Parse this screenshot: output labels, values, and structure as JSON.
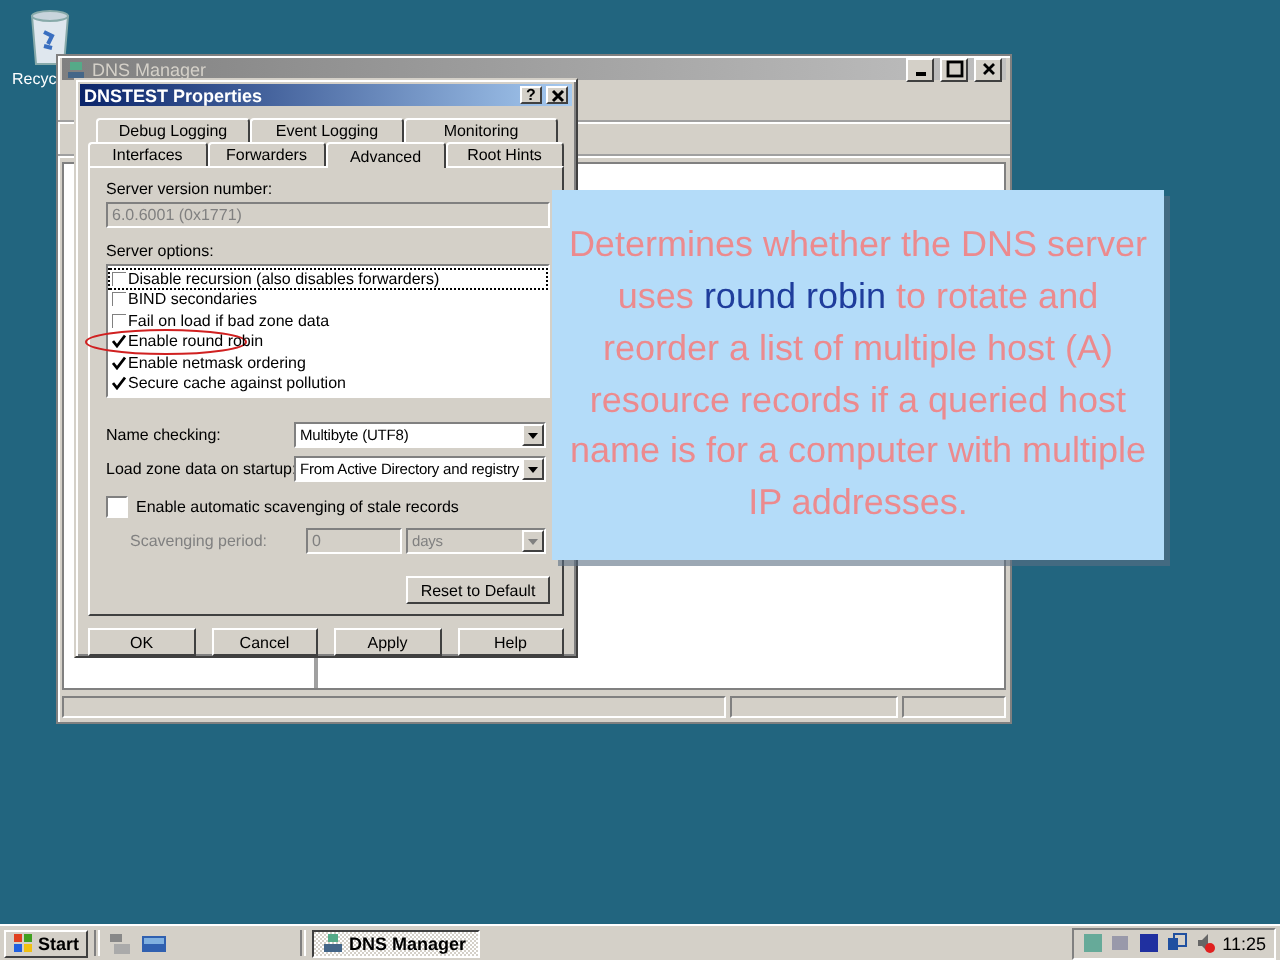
{
  "desktop": {
    "icon_label": "Recyc"
  },
  "background_window": {
    "title": "DNS Manager"
  },
  "dialog": {
    "title": "DNSTEST Properties",
    "help_button": "?",
    "tab_rows": [
      [
        {
          "label": "Debug Logging",
          "selected": false
        },
        {
          "label": "Event Logging",
          "selected": false
        },
        {
          "label": "Monitoring",
          "selected": false
        }
      ],
      [
        {
          "label": "Interfaces",
          "selected": false
        },
        {
          "label": "Forwarders",
          "selected": false
        },
        {
          "label": "Advanced",
          "selected": true
        },
        {
          "label": "Root Hints",
          "selected": false
        }
      ]
    ],
    "version_label": "Server version number:",
    "version_value": "6.0.6001 (0x1771)",
    "options_label": "Server options:",
    "options": [
      {
        "label": "Disable recursion (also disables forwarders)",
        "checked": false,
        "focused": true,
        "circled": false
      },
      {
        "label": "BIND secondaries",
        "checked": false,
        "focused": false,
        "circled": false
      },
      {
        "label": "Fail on load if bad zone data",
        "checked": false,
        "focused": false,
        "circled": false
      },
      {
        "label": "Enable round robin",
        "checked": true,
        "focused": false,
        "circled": true
      },
      {
        "label": "Enable netmask ordering",
        "checked": true,
        "focused": false,
        "circled": false
      },
      {
        "label": "Secure cache against pollution",
        "checked": true,
        "focused": false,
        "circled": false
      }
    ],
    "dropdowns": [
      {
        "label": "Name checking:",
        "value": "Multibyte (UTF8)"
      },
      {
        "label": "Load zone data on startup:",
        "value": "From Active Directory and registry"
      }
    ],
    "scavenging": {
      "label": "Enable automatic scavenging of stale records",
      "checked": false
    },
    "period": {
      "label": "Scavenging period:",
      "value": "0",
      "unit": "days",
      "disabled": true
    },
    "reset_button": "Reset to Default",
    "buttons": [
      "OK",
      "Cancel",
      "Apply",
      "Help"
    ]
  },
  "callout": {
    "parts": [
      {
        "text": "Determines whether the DNS server uses ",
        "highlight": false
      },
      {
        "text": "round robin",
        "highlight": true
      },
      {
        "text": " to rotate and reorder a list of multiple host (A) resource records if a queried host name is for a computer with multiple IP addresses.",
        "highlight": false
      }
    ]
  },
  "taskbar": {
    "start": "Start",
    "tasks": [
      {
        "label": "DNS Manager",
        "selected": true
      }
    ],
    "clock": "11:25"
  }
}
